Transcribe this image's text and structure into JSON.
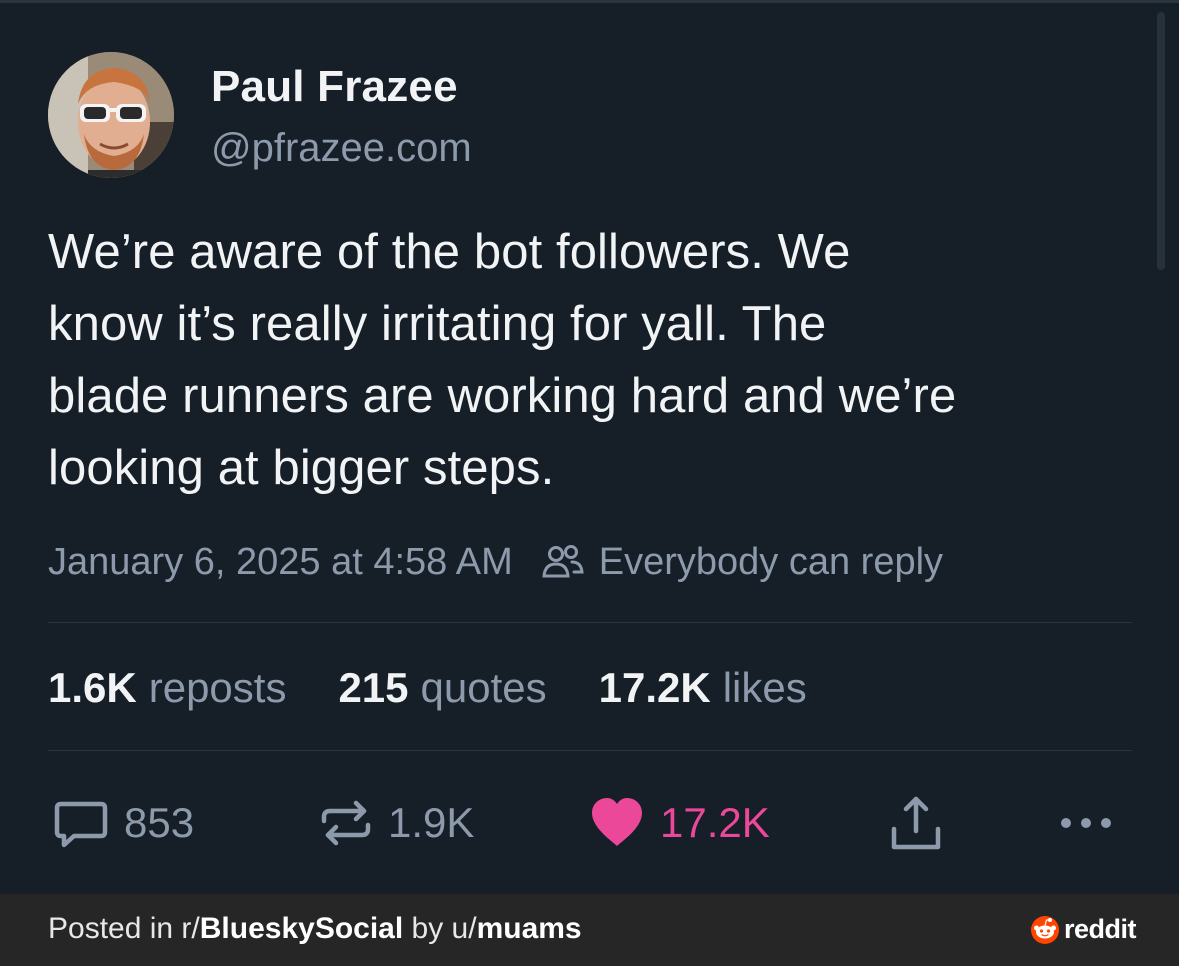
{
  "post": {
    "author": {
      "display_name": "Paul Frazee",
      "handle": "@pfrazee.com"
    },
    "text": "We’re aware of the bot followers. We\nknow it’s really irritating for yall. The\nblade runners are working hard and we’re\nlooking at bigger steps.",
    "timestamp": "January 6, 2025 at 4:58 AM",
    "reply_setting": "Everybody can reply",
    "stats": [
      {
        "number": "1.6K",
        "label": "reposts"
      },
      {
        "number": "215",
        "label": "quotes"
      },
      {
        "number": "17.2K",
        "label": "likes"
      }
    ],
    "actions": {
      "reply_count": "853",
      "repost_count": "1.9K",
      "like_count": "17.2K"
    }
  },
  "footer": {
    "posted_in_prefix": "Posted in r/",
    "subreddit": "BlueskySocial",
    "by_prefix": " by u/",
    "username": "muams",
    "brand": "reddit"
  },
  "icons": {
    "reply": "speech-bubble-icon",
    "repost": "repost-arrows-icon",
    "like": "heart-icon",
    "share": "share-icon",
    "more": "ellipsis-icon",
    "reply_setting": "people-icon",
    "brand": "reddit-snoo-icon"
  },
  "colors": {
    "background": "#161e27",
    "text_primary": "#f1f3f5",
    "text_secondary": "#8c9aac",
    "like_pink": "#ec4899",
    "footer_bg": "#262626",
    "reddit_orange": "#ff4500"
  }
}
